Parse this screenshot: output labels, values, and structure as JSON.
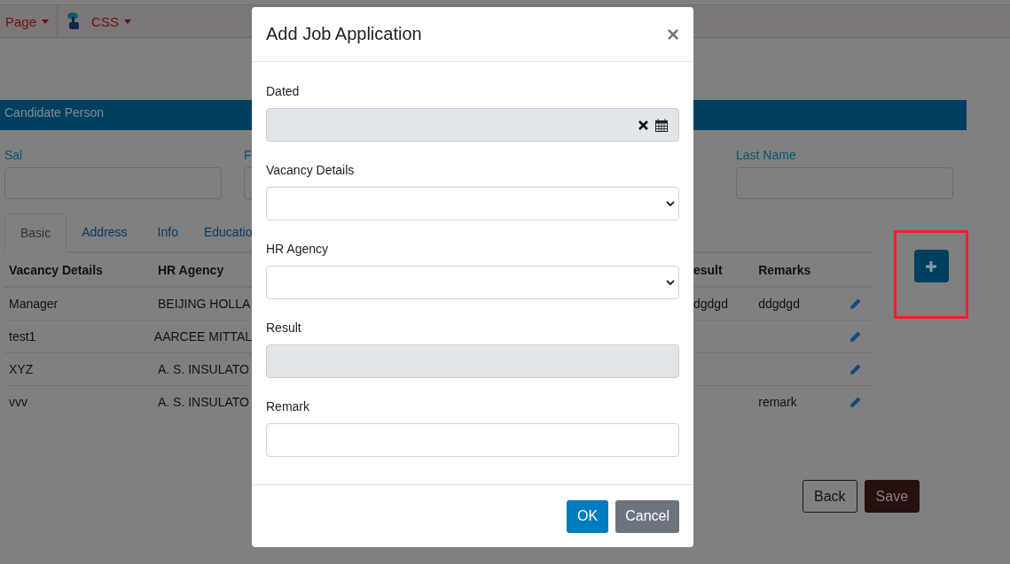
{
  "top_nav": {
    "menus": [
      {
        "label": "Page",
        "kind": "plain"
      },
      {
        "label": "CSS",
        "kind": "icon"
      }
    ]
  },
  "panel": {
    "title": "Candidate Person",
    "left_fields": [
      {
        "label": "Sal"
      },
      {
        "label": "F"
      }
    ],
    "right_fields": [
      {
        "label": "Last Name"
      }
    ]
  },
  "tabs": [
    {
      "label": "Basic",
      "selected": true
    },
    {
      "label": "Address",
      "selected": false
    },
    {
      "label": "Info",
      "selected": false
    },
    {
      "label": "Educatio",
      "selected": false
    }
  ],
  "table_left": {
    "columns": [
      "Vacancy Details",
      "HR Agency"
    ],
    "rows": [
      [
        "Manager",
        "BEIJING HOLLA"
      ],
      [
        "test1",
        "AARCEE MITTAL"
      ],
      [
        "XYZ",
        "A. S. INSULATO"
      ],
      [
        "vvv",
        "A. S. INSULATO"
      ]
    ]
  },
  "table_right": {
    "columns": [
      "esult",
      "Remarks"
    ],
    "rows": [
      {
        "column_1": "dgdgd",
        "remarks": "ddgdgd"
      },
      {},
      {},
      {
        "remarks": "remark"
      }
    ]
  },
  "add_button": {
    "highlighted": true
  },
  "page_buttons": [
    {
      "label": "Back",
      "kind": "outline"
    },
    {
      "label": "Save",
      "kind": "solid"
    }
  ],
  "modal": {
    "title": "Add Job Application",
    "close": "×",
    "fields": [
      {
        "label": "Dated",
        "kind": "date",
        "disabled": true
      },
      {
        "label": "Vacancy Details",
        "kind": "select",
        "disabled": false
      },
      {
        "label": "HR Agency",
        "kind": "select",
        "disabled": false
      },
      {
        "label": "Result",
        "kind": "text",
        "disabled": true
      },
      {
        "label": "Remark",
        "kind": "text",
        "disabled": false
      }
    ],
    "buttons": [
      {
        "label": "OK",
        "kind": "primary"
      },
      {
        "label": "Cancel",
        "kind": "secondary"
      }
    ]
  }
}
